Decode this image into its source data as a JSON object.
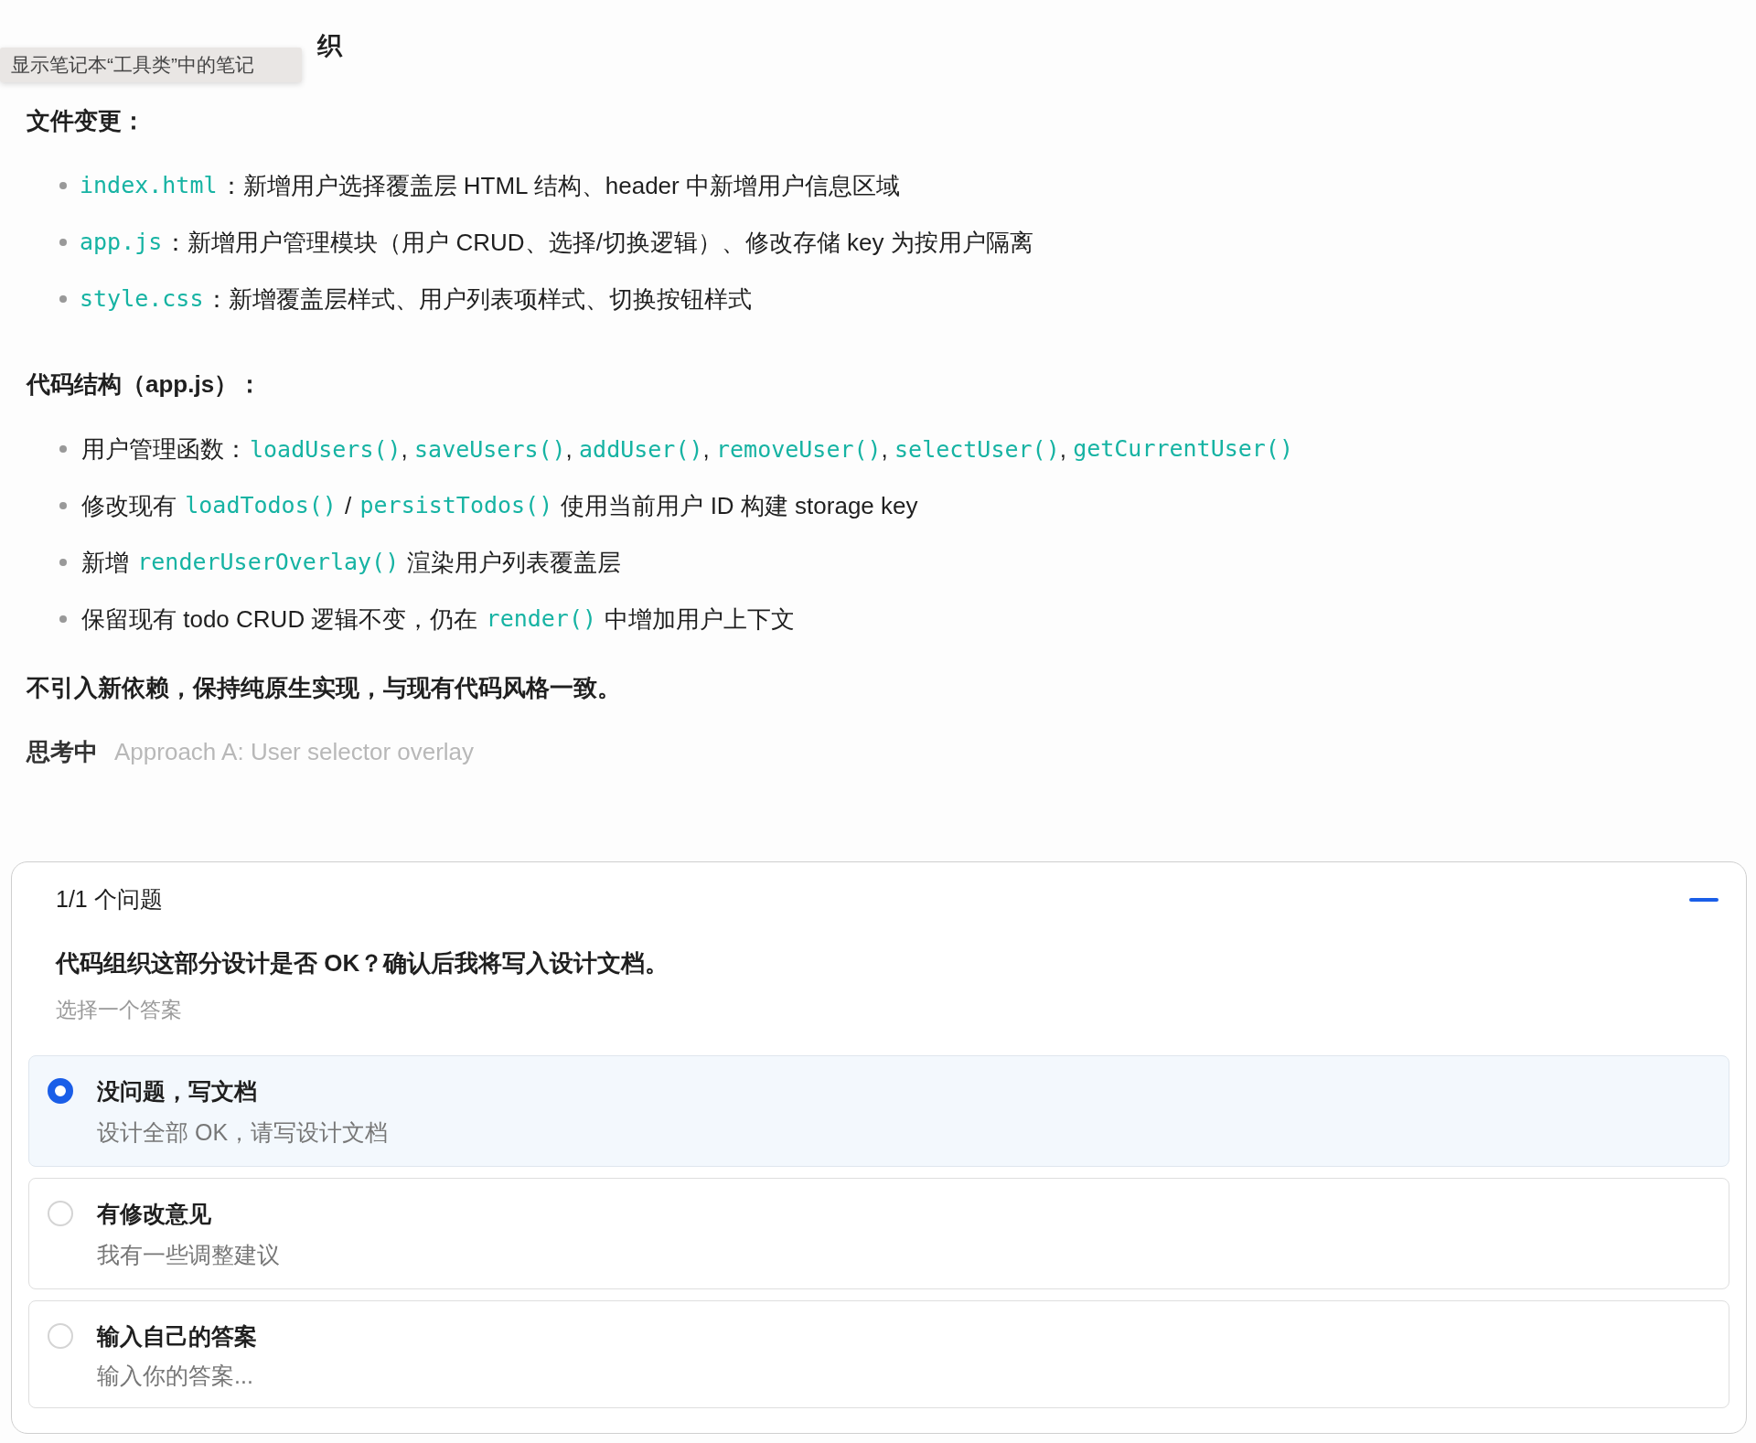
{
  "heading": "织",
  "tooltip": "显示笔记本“工具类”中的笔记",
  "sections": [
    {
      "title": "文件变更：",
      "items": [
        [
          {
            "kind": "code",
            "text": "index.html"
          },
          {
            "kind": "text",
            "text": "：新增用户选择覆盖层 HTML 结构、header 中新增用户信息区域"
          }
        ],
        [
          {
            "kind": "code",
            "text": "app.js"
          },
          {
            "kind": "text",
            "text": "：新增用户管理模块（用户 CRUD、选择/切换逻辑）、修改存储 key 为按用户隔离"
          }
        ],
        [
          {
            "kind": "code",
            "text": "style.css"
          },
          {
            "kind": "text",
            "text": "：新增覆盖层样式、用户列表项样式、切换按钮样式"
          }
        ]
      ]
    },
    {
      "title": "代码结构（app.js）：",
      "items": [
        [
          {
            "kind": "text",
            "text": "用户管理函数："
          },
          {
            "kind": "code",
            "text": "loadUsers()",
            "after": ", "
          },
          {
            "kind": "code",
            "text": "saveUsers()",
            "after": ", "
          },
          {
            "kind": "code",
            "text": "addUser()",
            "after": ", "
          },
          {
            "kind": "code",
            "text": "removeUser()",
            "after": ", "
          },
          {
            "kind": "code",
            "text": "selectUser()",
            "after": ", "
          },
          {
            "kind": "code",
            "text": "getCurrentUser()"
          }
        ],
        [
          {
            "kind": "text",
            "text": "修改现有 "
          },
          {
            "kind": "code",
            "text": "loadTodos()"
          },
          {
            "kind": "text",
            "text": " / "
          },
          {
            "kind": "code",
            "text": "persistTodos()"
          },
          {
            "kind": "text",
            "text": " 使用当前用户 ID 构建 storage key"
          }
        ],
        [
          {
            "kind": "text",
            "text": "新增 "
          },
          {
            "kind": "code",
            "text": "renderUserOverlay()"
          },
          {
            "kind": "text",
            "text": " 渲染用户列表覆盖层"
          }
        ],
        [
          {
            "kind": "text",
            "text": "保留现有 todo CRUD 逻辑不变，仍在 "
          },
          {
            "kind": "code",
            "text": "render()"
          },
          {
            "kind": "text",
            "text": " 中增加用户上下文"
          }
        ]
      ]
    }
  ],
  "closing": "不引入新依赖，保持纯原生实现，与现有代码风格一致。",
  "thinking": {
    "label": "思考中",
    "text": "Approach A: User selector overlay"
  },
  "question_card": {
    "counter": "1/1 个问题",
    "question": "代码组织这部分设计是否 OK？确认后我将写入设计文档。",
    "hint": "选择一个答案",
    "options": [
      {
        "kind": "choice",
        "title": "没问题，写文档",
        "subtitle": "设计全部 OK，请写设计文档",
        "selected": true
      },
      {
        "kind": "choice",
        "title": "有修改意见",
        "subtitle": "我有一些调整建议",
        "selected": false
      },
      {
        "kind": "custom",
        "title": "输入自己的答案",
        "placeholder": "输入你的答案...",
        "selected": false
      }
    ]
  }
}
